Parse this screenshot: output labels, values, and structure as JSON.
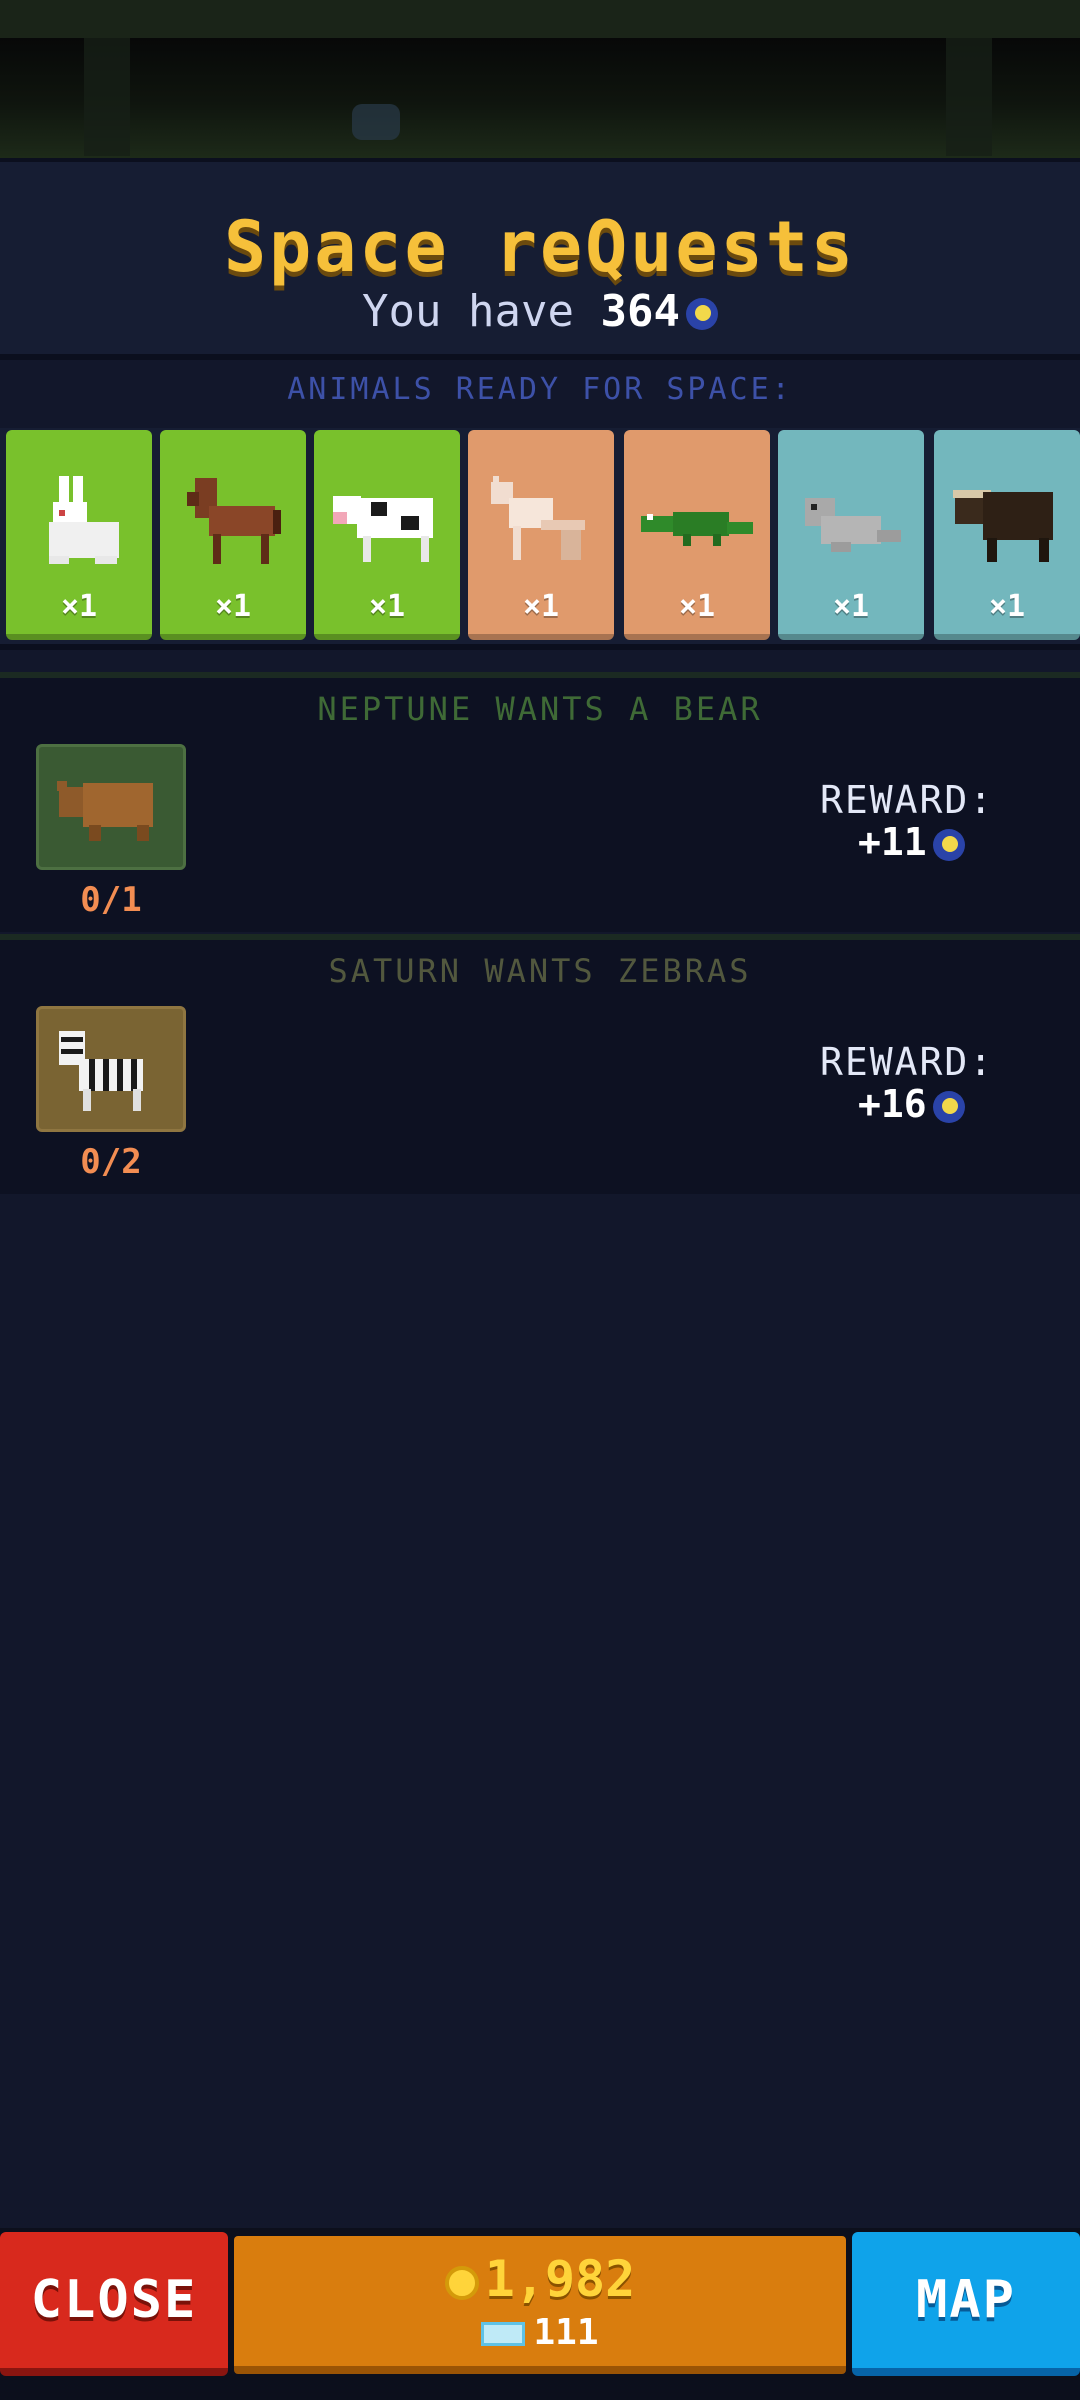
{
  "header": {
    "title": "Space reQuests",
    "have_prefix": "You have",
    "have_amount": "364",
    "currency_icon": "moon-token-icon"
  },
  "ready": {
    "label": "ANIMALS READY FOR SPACE:",
    "animals": [
      {
        "name": "rabbit",
        "count": "×1",
        "bg": "#79c12c"
      },
      {
        "name": "horse",
        "count": "×1",
        "bg": "#79c12c"
      },
      {
        "name": "cow",
        "count": "×1",
        "bg": "#79c12c"
      },
      {
        "name": "fox",
        "count": "×1",
        "bg": "#e09a6c"
      },
      {
        "name": "crocodile",
        "count": "×1",
        "bg": "#e09a6c"
      },
      {
        "name": "seal",
        "count": "×1",
        "bg": "#73b7bd"
      },
      {
        "name": "musk-ox",
        "count": "×1",
        "bg": "#73b7bd"
      }
    ]
  },
  "quests": [
    {
      "title": "NEPTUNE WANTS A BEAR",
      "animal": "bear",
      "progress": "0/1",
      "reward_label": "REWARD:",
      "reward_value": "+11",
      "title_color": "#3f6a36",
      "icon_bg": "#3a5a33"
    },
    {
      "title": "SATURN WANTS ZEBRAS",
      "animal": "zebra",
      "progress": "0/2",
      "reward_label": "REWARD:",
      "reward_value": "+16",
      "title_color": "#52583e",
      "icon_bg": "#7a6433"
    }
  ],
  "bottom": {
    "close_label": "CLOSE",
    "map_label": "MAP",
    "coins": "1,982",
    "gems": "111"
  },
  "colors": {
    "title": "#f6c03a",
    "close": "#d8291d",
    "map": "#0fa3ea",
    "money": "#d97d0e"
  }
}
